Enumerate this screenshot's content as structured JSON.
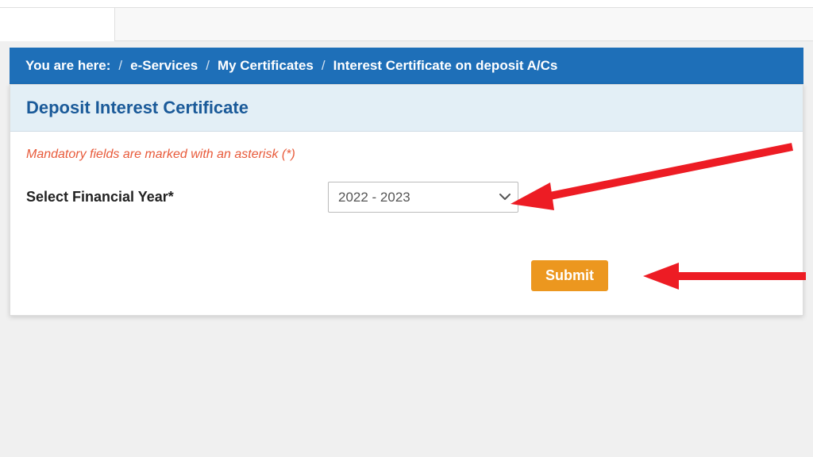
{
  "breadcrumb": {
    "label": "You are here:",
    "items": [
      "e-Services",
      "My Certificates",
      "Interest Certificate on deposit A/Cs"
    ]
  },
  "panel": {
    "title": "Deposit Interest Certificate",
    "mandatory_note": "Mandatory fields are marked with an asterisk (*)"
  },
  "form": {
    "fy_label": "Select Financial Year*",
    "fy_value": "2022 - 2023",
    "submit_label": "Submit"
  },
  "colors": {
    "breadcrumb_bg": "#1e6fb8",
    "title_color": "#1a5a99",
    "note_color": "#e85a3a",
    "submit_bg": "#ec971f",
    "arrow_red": "#ed1c24"
  }
}
